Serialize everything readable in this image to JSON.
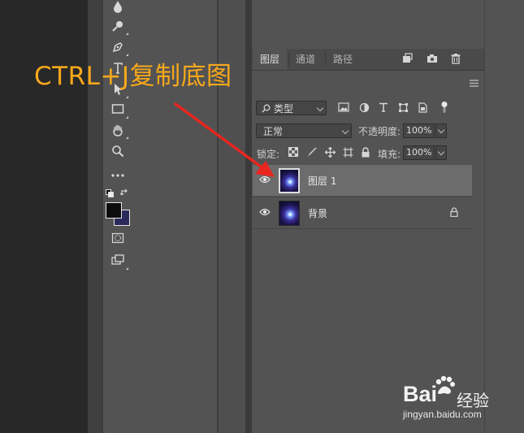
{
  "annotation": {
    "text": "CTRL+J复制底图",
    "color": "#f7a81b"
  },
  "panel": {
    "tabs": [
      {
        "label": "图层",
        "active": true
      },
      {
        "label": "通道",
        "active": false
      },
      {
        "label": "路径",
        "active": false
      }
    ],
    "filter": {
      "value": "类型"
    },
    "blend_mode": {
      "value": "正常"
    },
    "opacity": {
      "label": "不透明度:",
      "value": "100%"
    },
    "lock": {
      "label": "锁定:"
    },
    "fill": {
      "label": "填充:",
      "value": "100%"
    },
    "layers": [
      {
        "name": "图层 1",
        "selected": true,
        "locked": false
      },
      {
        "name": "背景",
        "selected": false,
        "locked": true
      }
    ]
  },
  "icons": {
    "top_panel": [
      "new-layer-icon",
      "camera-icon",
      "trash-icon"
    ],
    "filter": [
      "image-filter-icon",
      "adjustment-filter-icon",
      "text-filter-icon",
      "shape-filter-icon",
      "smart-object-filter-icon",
      "filter-toggle-icon"
    ],
    "lock": [
      "lock-transparent-icon",
      "lock-image-icon",
      "lock-position-icon",
      "lock-artboard-icon",
      "lock-all-icon"
    ]
  },
  "colors": {
    "foreground": "#0c0c0c",
    "background": "#2a2a5a"
  },
  "watermark": {
    "logo": "Bai",
    "logo_suffix": "经验",
    "url": "jingyan.baidu.com"
  }
}
